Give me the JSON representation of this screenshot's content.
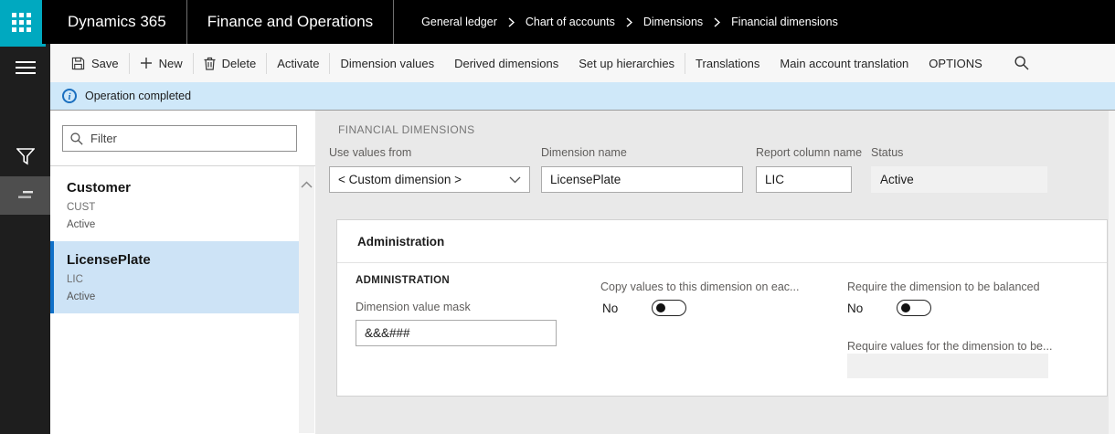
{
  "topbar": {
    "app": "Dynamics 365",
    "product": "Finance and Operations",
    "breadcrumb": [
      "General ledger",
      "Chart of accounts",
      "Dimensions",
      "Financial dimensions"
    ]
  },
  "toolbar": {
    "items": [
      {
        "label": "Save",
        "icon": "save-icon"
      },
      {
        "label": "New",
        "icon": "plus-icon"
      },
      {
        "label": "Delete",
        "icon": "trash-icon"
      },
      {
        "label": "Activate"
      },
      {
        "label": "Dimension values"
      },
      {
        "label": "Derived dimensions"
      },
      {
        "label": "Set up hierarchies"
      },
      {
        "label": "Translations"
      },
      {
        "label": "Main account translation"
      },
      {
        "label": "OPTIONS"
      }
    ],
    "search_icon": "search-icon"
  },
  "message_bar": {
    "icon": "info-icon",
    "text": "Operation completed"
  },
  "sidebar": {
    "icons": [
      "hamburger-icon",
      "filter-icon",
      "dimension-list-icon"
    ],
    "selected": "dimension-list-icon"
  },
  "left_panel": {
    "filter_placeholder": "Filter",
    "items": [
      {
        "name": "Customer",
        "code": "CUST",
        "status": "Active",
        "selected": false
      },
      {
        "name": "LicensePlate",
        "code": "LIC",
        "status": "Active",
        "selected": true
      }
    ]
  },
  "main": {
    "section_title": "FINANCIAL DIMENSIONS",
    "fields": {
      "use_values_from": {
        "label": "Use values from",
        "value": "< Custom dimension >"
      },
      "dimension_name": {
        "label": "Dimension name",
        "value": "LicensePlate"
      },
      "report_column_name": {
        "label": "Report column name",
        "value": "LIC"
      },
      "status": {
        "label": "Status",
        "value": "Active"
      }
    },
    "administration": {
      "header": "Administration",
      "subheader": "ADMINISTRATION",
      "dimension_value_mask": {
        "label": "Dimension value mask",
        "value": "&&&###"
      },
      "copy_values": {
        "label": "Copy values to this dimension on eac...",
        "value": "No",
        "enabled": false
      },
      "require_balanced": {
        "label": "Require the dimension to be balanced",
        "value": "No",
        "enabled": false
      },
      "require_values": {
        "label": "Require values for the dimension to be...",
        "value": ""
      }
    }
  },
  "colors": {
    "topbar_bg": "#000000",
    "waffle_tile": "#00a9c0",
    "sidebar_bg": "#1e1e1e",
    "sidebar_selected_bg": "#4e4e4e",
    "message_bar_bg": "#cfe8f9",
    "info_icon_blue": "#1a6fbf",
    "selected_item_bg": "#cde3f6",
    "selected_item_border": "#1070c8",
    "main_bg": "#e9e9e9"
  }
}
